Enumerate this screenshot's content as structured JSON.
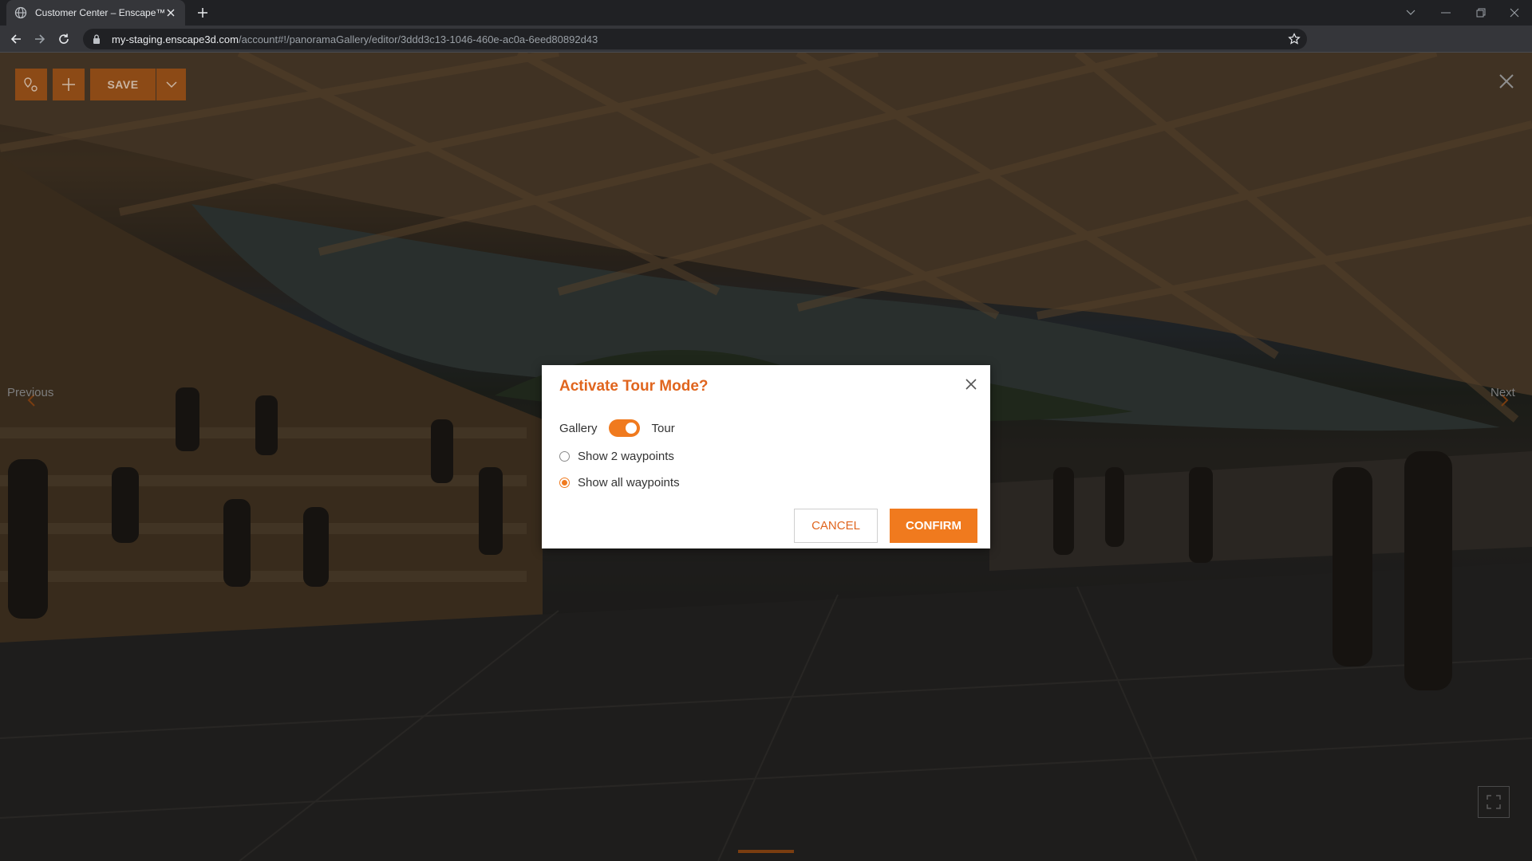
{
  "browser": {
    "tab_title": "Customer Center – Enscape™",
    "url_host": "my-staging.enscape3d.com",
    "url_path": "/account#!/panoramaGallery/editor/3ddd3c13-1046-460e-ac0a-6eed80892d43",
    "icons": [
      "globe-icon",
      "close-icon",
      "plus-icon",
      "chevron-down-icon",
      "minimize-icon",
      "restore-icon",
      "close-icon",
      "arrow-left-icon",
      "arrow-right-icon",
      "reload-icon",
      "lock-icon",
      "star-icon"
    ]
  },
  "toolbar": {
    "save_label": "SAVE",
    "icons": [
      "location-pin-icon",
      "plus-icon",
      "chevron-down-icon"
    ]
  },
  "viewer": {
    "previous_label": "Previous",
    "next_label": "Next",
    "icons": [
      "close-icon",
      "chevron-left-icon",
      "chevron-right-icon",
      "fullscreen-icon"
    ]
  },
  "modal": {
    "title": "Activate Tour Mode?",
    "toggle_left_label": "Gallery",
    "toggle_right_label": "Tour",
    "toggle_on": true,
    "options": [
      {
        "label": "Show 2 waypoints",
        "selected": false
      },
      {
        "label": "Show all waypoints",
        "selected": true
      }
    ],
    "cancel_label": "CANCEL",
    "confirm_label": "CONFIRM"
  },
  "colors": {
    "accent": "#f07a1e",
    "title": "#e0651e",
    "toolbar_dimmed": "#8c4a16"
  }
}
